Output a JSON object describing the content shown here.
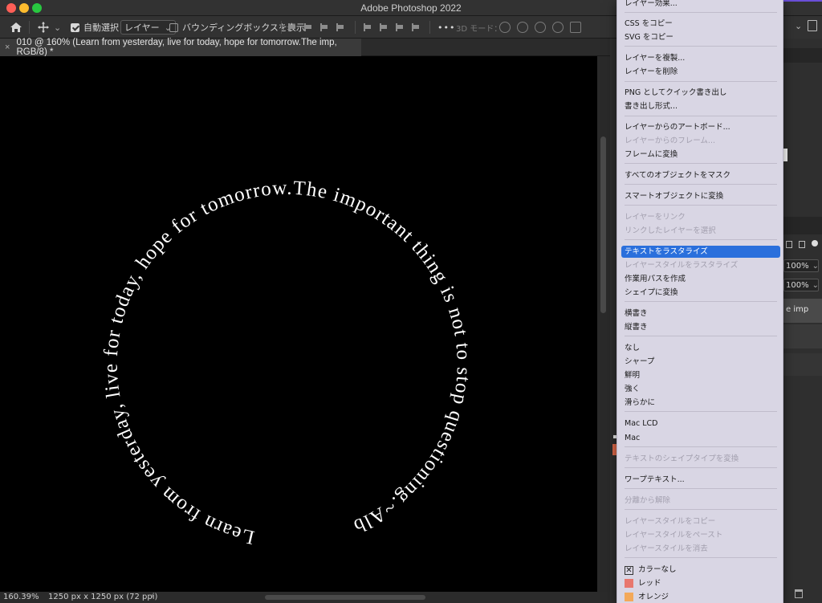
{
  "window": {
    "app_title": "Adobe Photoshop 2022"
  },
  "options_bar": {
    "auto_select_label": "自動選択：",
    "auto_select_value": "レイヤー",
    "bounding_box_label": "バウンディングボックスを表示",
    "more_label": "•••",
    "mode_3d_label": "3D モード："
  },
  "document": {
    "tab_close": "×",
    "tab_title": "010 @ 160% (Learn from yesterday, live for today, hope for tomorrow.The imp, RGB/8) *",
    "circle_text": "Learn from yesterday, live for today, hope for tomorrow.The important thing is not to stop questioning.~Albert"
  },
  "status": {
    "zoom": "160.39%",
    "doc_size": "1250 px x 1250 px (72 ppi)",
    "arrow": "›"
  },
  "right_panel": {
    "opacity_1": "100%",
    "opacity_2": "100%",
    "layer_name": "e imp"
  },
  "context_menu": {
    "items": [
      {
        "label": "レイヤー効果...",
        "disabled": false
      },
      {
        "label": "CSS をコピー",
        "disabled": false
      },
      {
        "label": "SVG をコピー",
        "disabled": false
      },
      {
        "label": "レイヤーを複製...",
        "disabled": false
      },
      {
        "label": "レイヤーを削除",
        "disabled": false
      },
      {
        "label": "PNG としてクイック書き出し",
        "disabled": false
      },
      {
        "label": "書き出し形式...",
        "disabled": false
      },
      {
        "label": "レイヤーからのアートボード...",
        "disabled": false
      },
      {
        "label": "レイヤーからのフレーム...",
        "disabled": true
      },
      {
        "label": "フレームに変換",
        "disabled": false
      },
      {
        "label": "すべてのオブジェクトをマスク",
        "disabled": false
      },
      {
        "label": "スマートオブジェクトに変換",
        "disabled": false
      },
      {
        "label": "レイヤーをリンク",
        "disabled": true
      },
      {
        "label": "リンクしたレイヤーを選択",
        "disabled": true
      },
      {
        "label": "テキストをラスタライズ",
        "disabled": false,
        "selected": true
      },
      {
        "label": "レイヤースタイルをラスタライズ",
        "disabled": true
      },
      {
        "label": "作業用パスを作成",
        "disabled": false
      },
      {
        "label": "シェイプに変換",
        "disabled": false
      },
      {
        "label": "横書き",
        "disabled": false
      },
      {
        "label": "縦書き",
        "disabled": false
      },
      {
        "label": "なし",
        "disabled": false
      },
      {
        "label": "シャープ",
        "disabled": false
      },
      {
        "label": "鮮明",
        "disabled": false
      },
      {
        "label": "強く",
        "disabled": false
      },
      {
        "label": "滑らかに",
        "disabled": false
      },
      {
        "label": "Mac LCD",
        "disabled": false
      },
      {
        "label": "Mac",
        "disabled": false
      },
      {
        "label": "テキストのシェイプタイプを変換",
        "disabled": true
      },
      {
        "label": "ワープテキスト...",
        "disabled": false
      },
      {
        "label": "分離から解除",
        "disabled": true
      },
      {
        "label": "レイヤースタイルをコピー",
        "disabled": true
      },
      {
        "label": "レイヤースタイルをペースト",
        "disabled": true
      },
      {
        "label": "レイヤースタイルを消去",
        "disabled": true
      },
      {
        "label": "カラーなし",
        "disabled": false,
        "check": "✕"
      },
      {
        "label": "レッド",
        "disabled": false,
        "swatch": "#e8776e"
      },
      {
        "label": "オレンジ",
        "disabled": false,
        "swatch": "#f3a95a"
      }
    ],
    "selected_color": "#2a6fdc"
  }
}
